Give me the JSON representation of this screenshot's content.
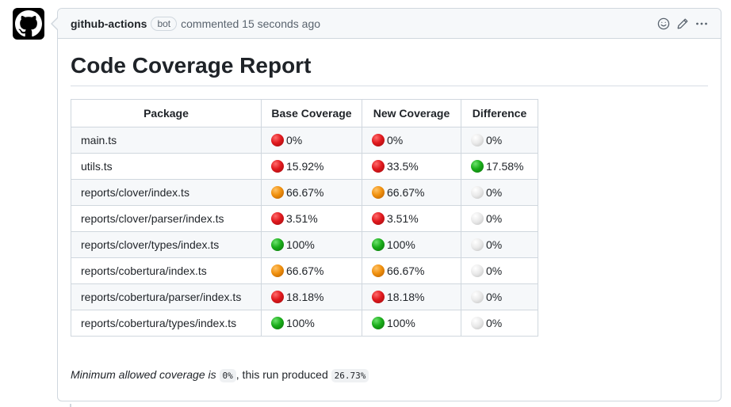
{
  "comment": {
    "author": "github-actions",
    "badge": "bot",
    "meta": "commented 15 seconds ago"
  },
  "header_icons": [
    "smiley-icon",
    "pencil-icon",
    "kebab-icon"
  ],
  "report": {
    "title": "Code Coverage Report",
    "columns": [
      "Package",
      "Base Coverage",
      "New Coverage",
      "Difference"
    ],
    "rows": [
      {
        "package": "main.ts",
        "base": {
          "status": "red",
          "value": "0%"
        },
        "new": {
          "status": "red",
          "value": "0%"
        },
        "diff": {
          "status": "white",
          "value": "0%"
        }
      },
      {
        "package": "utils.ts",
        "base": {
          "status": "red",
          "value": "15.92%"
        },
        "new": {
          "status": "red",
          "value": "33.5%"
        },
        "diff": {
          "status": "green",
          "value": "17.58%"
        }
      },
      {
        "package": "reports/clover/index.ts",
        "base": {
          "status": "orange",
          "value": "66.67%"
        },
        "new": {
          "status": "orange",
          "value": "66.67%"
        },
        "diff": {
          "status": "white",
          "value": "0%"
        }
      },
      {
        "package": "reports/clover/parser/index.ts",
        "base": {
          "status": "red",
          "value": "3.51%"
        },
        "new": {
          "status": "red",
          "value": "3.51%"
        },
        "diff": {
          "status": "white",
          "value": "0%"
        }
      },
      {
        "package": "reports/clover/types/index.ts",
        "base": {
          "status": "green",
          "value": "100%"
        },
        "new": {
          "status": "green",
          "value": "100%"
        },
        "diff": {
          "status": "white",
          "value": "0%"
        }
      },
      {
        "package": "reports/cobertura/index.ts",
        "base": {
          "status": "orange",
          "value": "66.67%"
        },
        "new": {
          "status": "orange",
          "value": "66.67%"
        },
        "diff": {
          "status": "white",
          "value": "0%"
        }
      },
      {
        "package": "reports/cobertura/parser/index.ts",
        "base": {
          "status": "red",
          "value": "18.18%"
        },
        "new": {
          "status": "red",
          "value": "18.18%"
        },
        "diff": {
          "status": "white",
          "value": "0%"
        }
      },
      {
        "package": "reports/cobertura/types/index.ts",
        "base": {
          "status": "green",
          "value": "100%"
        },
        "new": {
          "status": "green",
          "value": "100%"
        },
        "diff": {
          "status": "white",
          "value": "0%"
        }
      }
    ],
    "summary": {
      "prefix": "Minimum allowed coverage is",
      "minimum": "0%",
      "middle": ", this run produced",
      "produced": "26.73%"
    }
  },
  "colors": {
    "red": "#e0191e",
    "orange": "#f0900e",
    "green": "#1aac1a",
    "white": "#e8e8e8",
    "border": "#d0d7de",
    "header_bg": "#f6f8fa"
  }
}
